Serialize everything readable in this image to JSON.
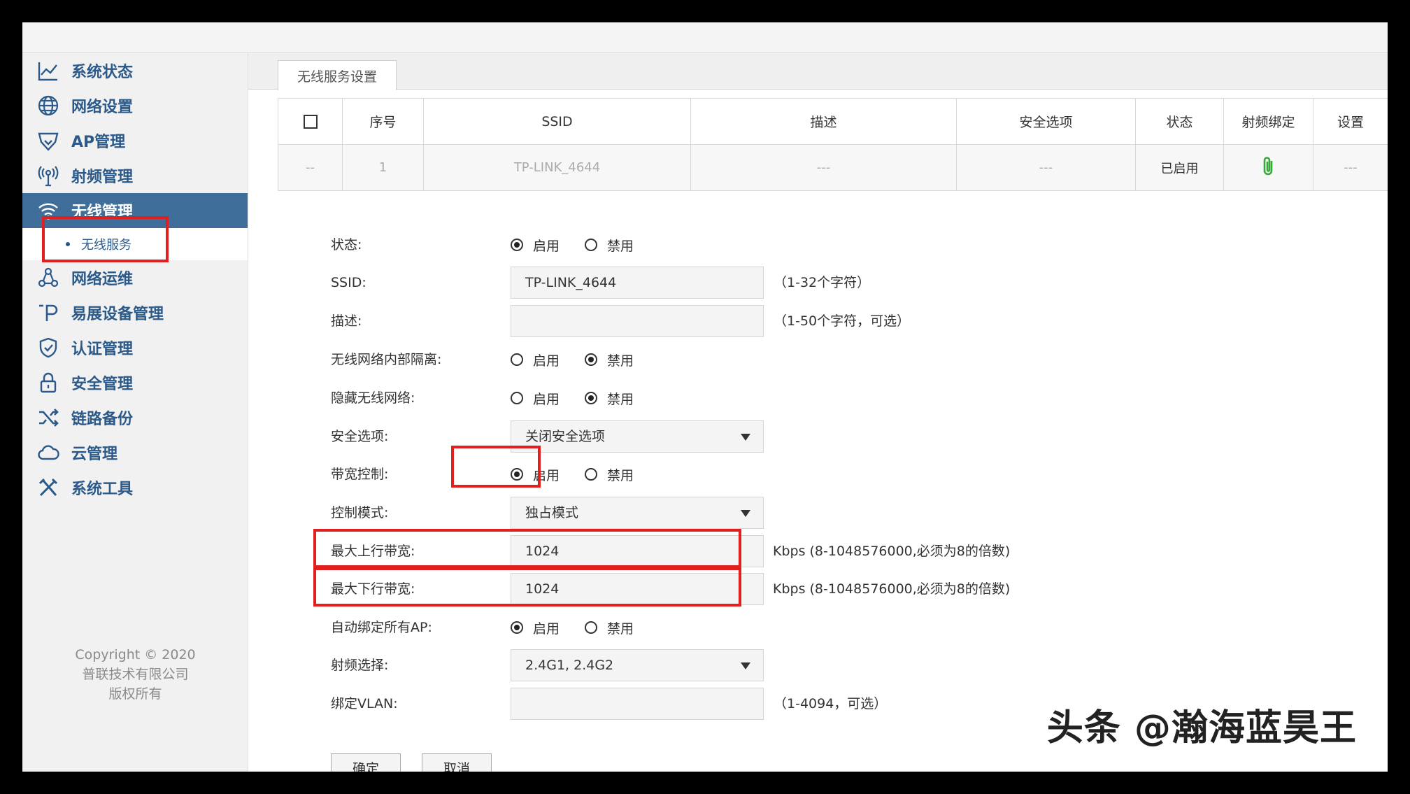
{
  "sidebar": {
    "items": [
      {
        "label": "系统状态",
        "icon": "chart-line-icon"
      },
      {
        "label": "网络设置",
        "icon": "globe-icon"
      },
      {
        "label": "AP管理",
        "icon": "ap-shield-icon"
      },
      {
        "label": "射频管理",
        "icon": "antenna-icon"
      },
      {
        "label": "无线管理",
        "icon": "wifi-icon"
      },
      {
        "label": "网络运维",
        "icon": "network-ops-icon"
      },
      {
        "label": "易展设备管理",
        "icon": "expand-device-icon"
      },
      {
        "label": "认证管理",
        "icon": "shield-check-icon"
      },
      {
        "label": "安全管理",
        "icon": "lock-icon"
      },
      {
        "label": "链路备份",
        "icon": "shuffle-icon"
      },
      {
        "label": "云管理",
        "icon": "cloud-icon"
      },
      {
        "label": "系统工具",
        "icon": "tools-icon"
      }
    ],
    "active_sub": "无线服务",
    "copyright": [
      "Copyright © 2020",
      "普联技术有限公司",
      "版权所有"
    ]
  },
  "tab": {
    "label": "无线服务设置"
  },
  "table": {
    "headers": [
      "",
      "序号",
      "SSID",
      "描述",
      "安全选项",
      "状态",
      "射频绑定",
      "设置"
    ],
    "row": [
      "--",
      "1",
      "TP-LINK_4644",
      "---",
      "---",
      "已启用",
      "",
      "---"
    ]
  },
  "form": {
    "status": {
      "label": "状态:",
      "on": "启用",
      "off": "禁用"
    },
    "ssid": {
      "label": "SSID:",
      "value": "TP-LINK_4644",
      "hint": "（1-32个字符）"
    },
    "desc": {
      "label": "描述:",
      "value": "",
      "hint": "（1-50个字符，可选）"
    },
    "isolation": {
      "label": "无线网络内部隔离:",
      "on": "启用",
      "off": "禁用"
    },
    "hidden": {
      "label": "隐藏无线网络:",
      "on": "启用",
      "off": "禁用"
    },
    "security": {
      "label": "安全选项:",
      "value": "关闭安全选项"
    },
    "bandwidth": {
      "label": "带宽控制:",
      "on": "启用",
      "off": "禁用"
    },
    "mode": {
      "label": "控制模式:",
      "value": "独占模式"
    },
    "up": {
      "label": "最大上行带宽:",
      "value": "1024",
      "hint": "Kbps (8-1048576000,必须为8的倍数)"
    },
    "down": {
      "label": "最大下行带宽:",
      "value": "1024",
      "hint": "Kbps (8-1048576000,必须为8的倍数)"
    },
    "autobind": {
      "label": "自动绑定所有AP:",
      "on": "启用",
      "off": "禁用"
    },
    "radio": {
      "label": "射频选择:",
      "value": "2.4G1, 2.4G2"
    },
    "vlan": {
      "label": "绑定VLAN:",
      "value": "",
      "hint": "（1-4094，可选）"
    }
  },
  "buttons": {
    "ok": "确定",
    "cancel": "取消"
  },
  "watermark": "头条 @瀚海蓝昊王",
  "colors": {
    "accent": "#3e6e99",
    "nav_text": "#2b5a8a",
    "highlight": "#e21f1f",
    "clip_green": "#3aa83a"
  }
}
